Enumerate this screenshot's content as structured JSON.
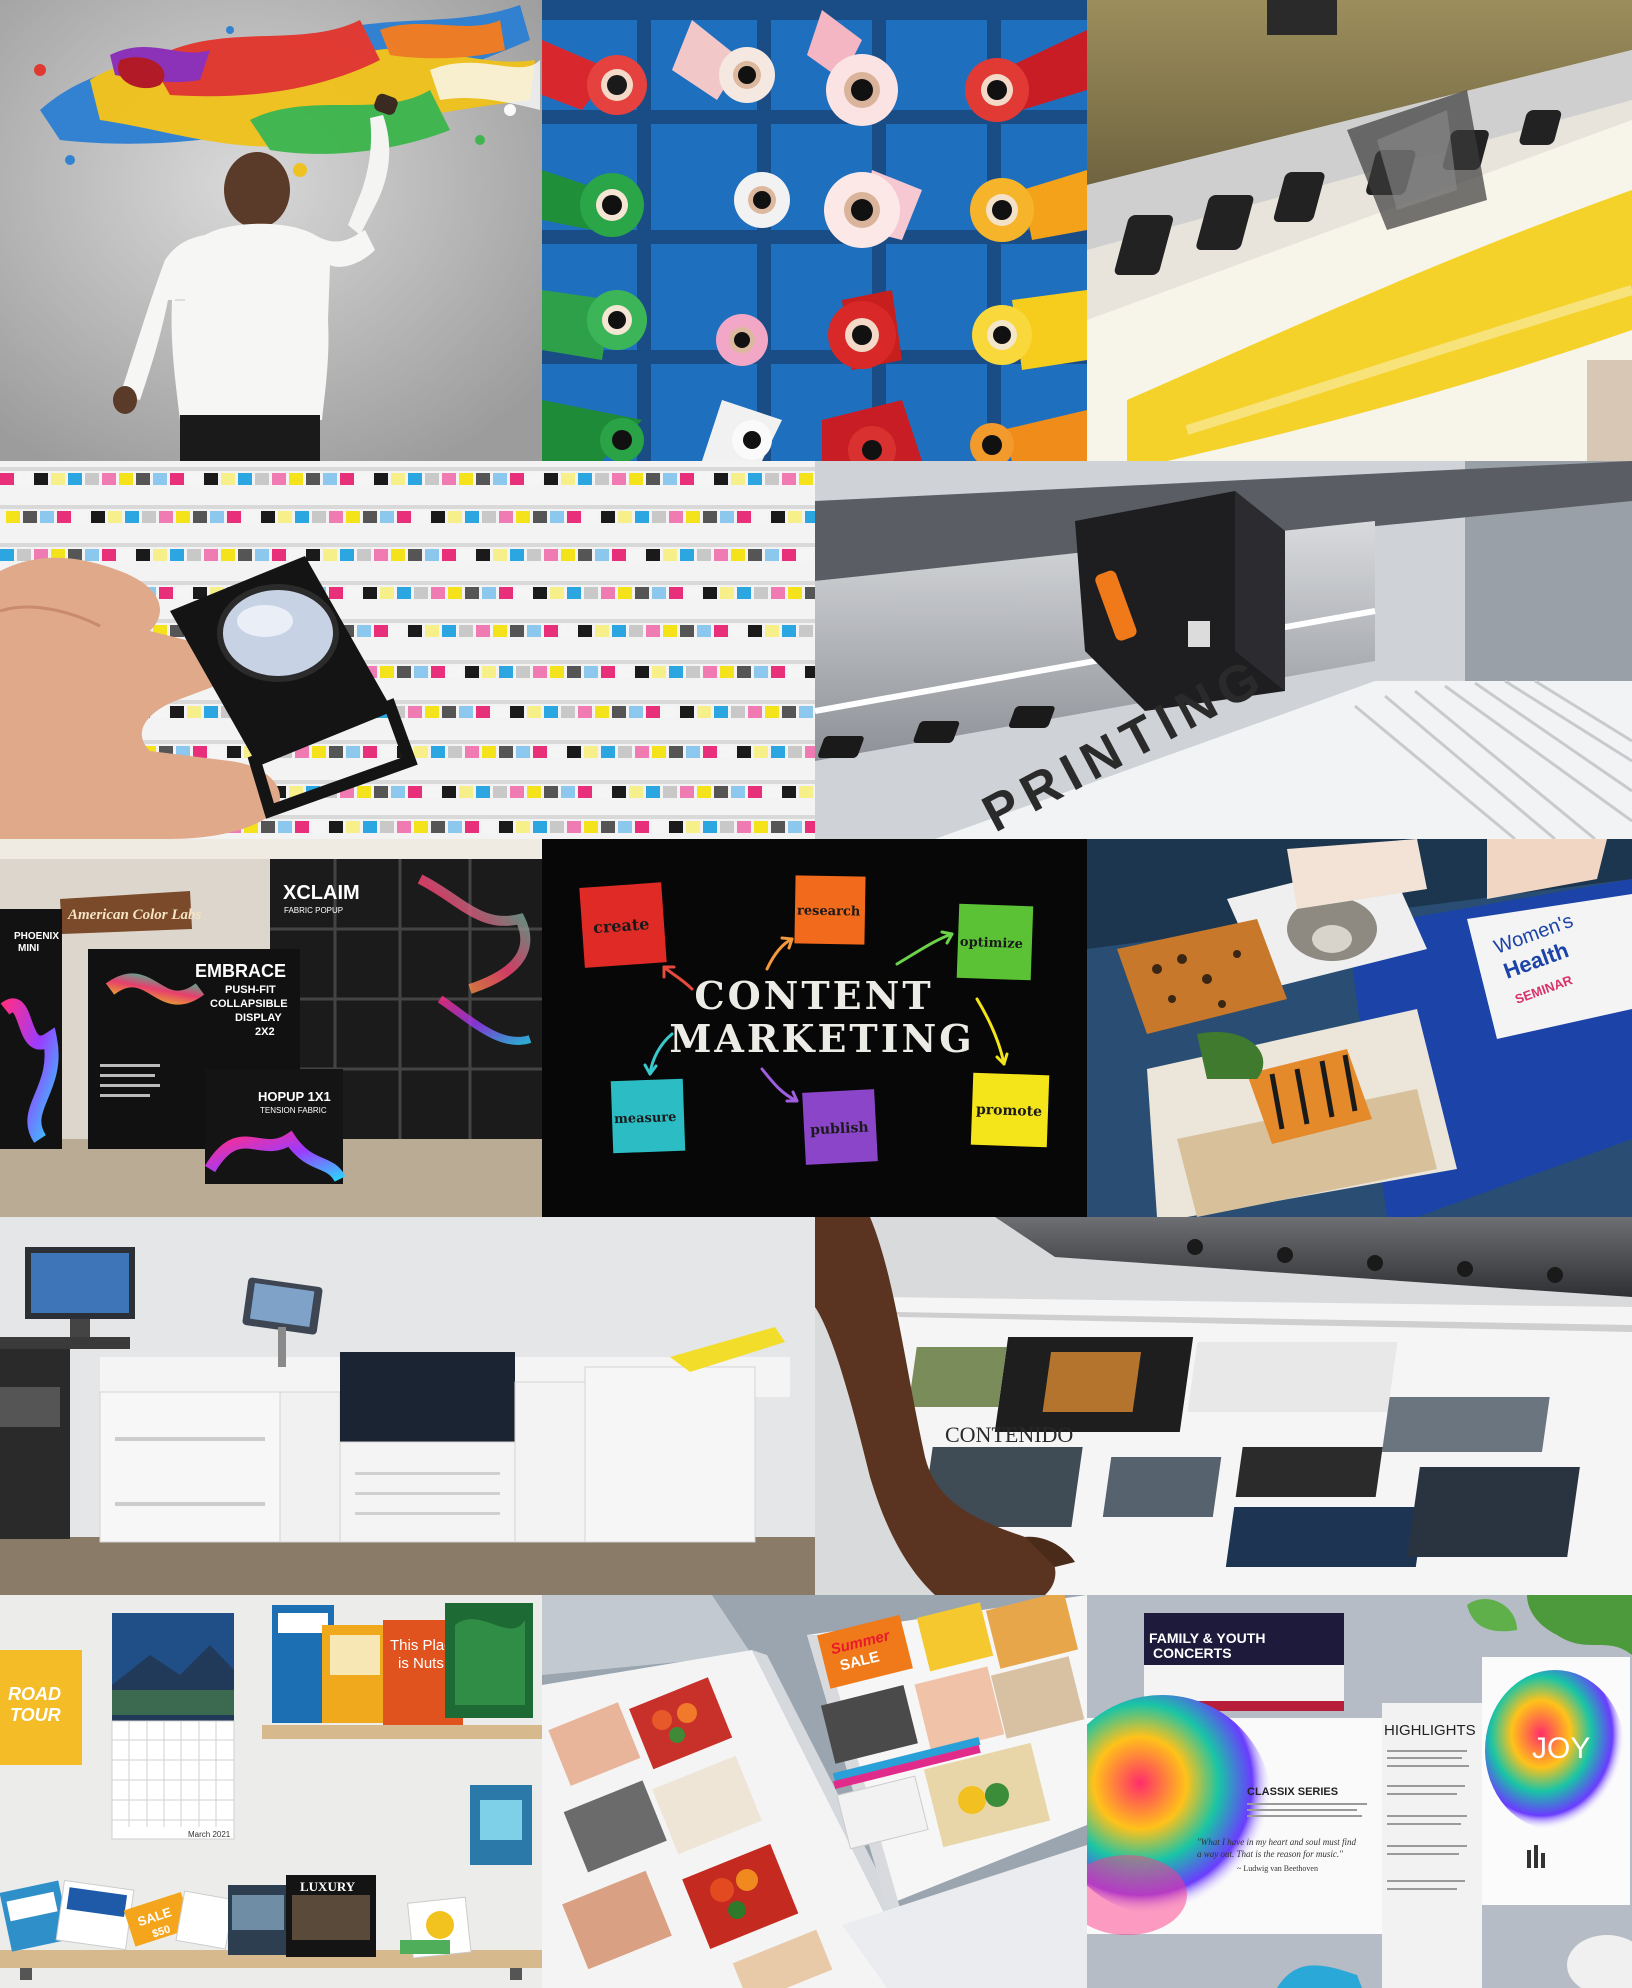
{
  "collage": {
    "tile_painter": {},
    "tile_rolls": {},
    "tile_printer": {},
    "tile_loupe": {},
    "tile_plotter": {
      "carriage_text": "PRINTING"
    },
    "tile_displays": {
      "wall_sign": "American Color Labs",
      "phoenix_line1": "PHOENIX",
      "phoenix_line2": "MINI",
      "xclaim_title": "XCLAIM",
      "xclaim_sub": "FABRIC POPUP",
      "embrace_title": "EMBRACE",
      "embrace_sub1": "PUSH-FIT",
      "embrace_sub2": "COLLAPSIBLE",
      "embrace_sub3": "DISPLAY",
      "embrace_sub4": "2X2",
      "hopup_title": "HOPUP 1X1",
      "hopup_sub": "TENSION FABRIC"
    },
    "tile_content_marketing": {
      "title_line1": "CONTENT",
      "title_line2": "MARKETING",
      "notes": {
        "create": "create",
        "research": "research",
        "optimize": "optimize",
        "measure": "measure",
        "publish": "publish",
        "promote": "promote"
      },
      "colors": {
        "create": "#e02a26",
        "research": "#f26a1b",
        "optimize": "#5bc236",
        "measure": "#2bbcc4",
        "publish": "#8a45c8",
        "promote": "#f4e41a"
      }
    },
    "tile_prints": {
      "poster_line1": "Women's",
      "poster_line2": "Health",
      "poster_line3": "SEMINAR"
    },
    "tile_digital_press": {},
    "tile_cutter": {
      "sheet_word": "CONTENIDO"
    },
    "tile_shelves": {
      "road_line1": "ROAD",
      "road_line2": "TOUR",
      "calendar_month": "March 2021",
      "nuts_line1": "This Place",
      "nuts_line2": "is Nuts.",
      "sale_card": "SALE",
      "sale_value": "$50",
      "luxury_mag": "LUXURY"
    },
    "tile_magazines": {
      "summer_line1": "Summer",
      "summer_line2": "SALE"
    },
    "tile_brochures": {
      "concert_line1": "FAMILY & YOUTH",
      "concert_line2": "CONCERTS",
      "classix": "CLASSIX SERIES",
      "quote_line1": "\"What I have in my heart and soul must find",
      "quote_line2": "a way out. That is the reason for music.\"",
      "quote_attr": "~ Ludwig van Beethoven",
      "highlights": "HIGHLIGHTS",
      "joy": "JOY"
    }
  }
}
